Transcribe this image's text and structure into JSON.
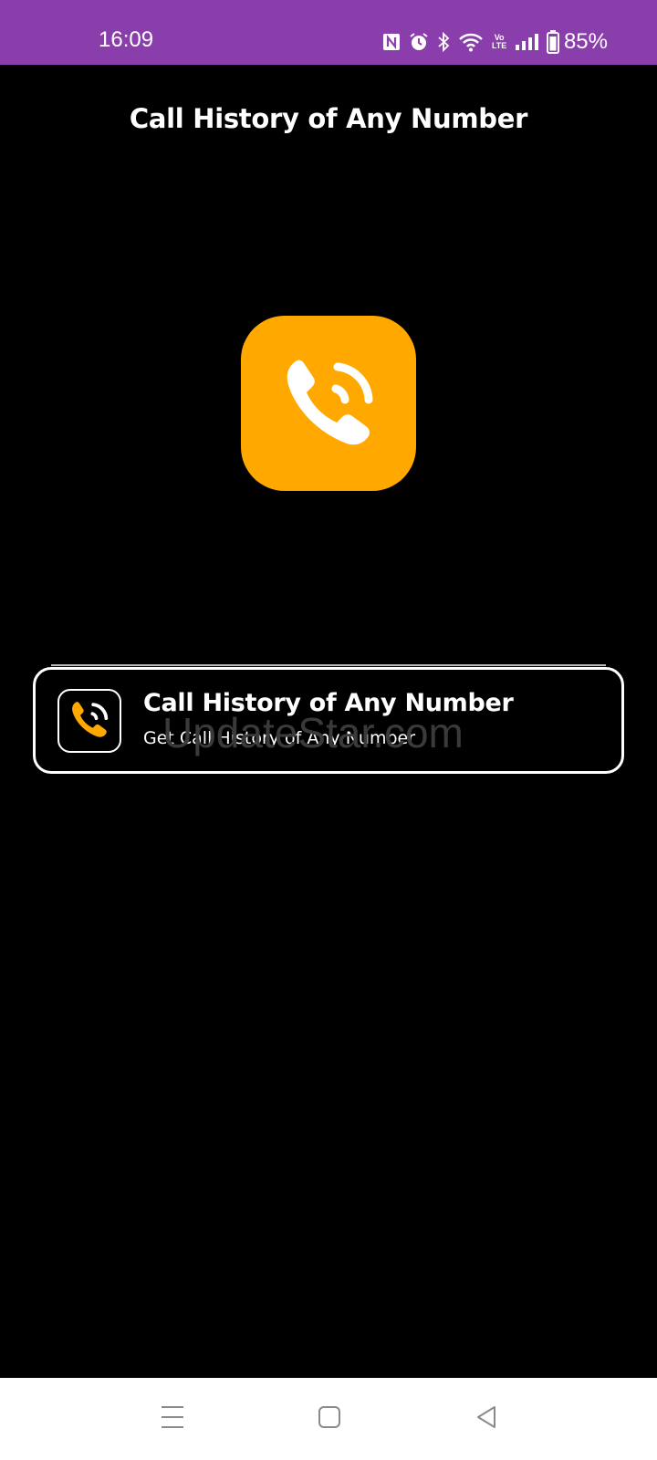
{
  "status_bar": {
    "time": "16:09",
    "volte_top": "Vo",
    "volte_bottom": "LTE",
    "battery_percent": "85%",
    "background_color": "#8a3eac",
    "icons": [
      "nfc-icon",
      "alarm-icon",
      "bluetooth-icon",
      "wifi-icon",
      "volte-icon",
      "signal-icon",
      "battery-icon"
    ]
  },
  "page": {
    "title": "Call History of Any Number",
    "logo_color": "#ffa800",
    "logo_icon": "phone-call-icon"
  },
  "card": {
    "title": "Call History of Any Number",
    "subtitle": "Get Call History of Any Number",
    "icon": "phone-call-icon"
  },
  "watermark": {
    "text": "UpdateStar.com"
  },
  "nav_bar": {
    "buttons": [
      "menu-icon",
      "home-icon",
      "back-icon"
    ]
  }
}
